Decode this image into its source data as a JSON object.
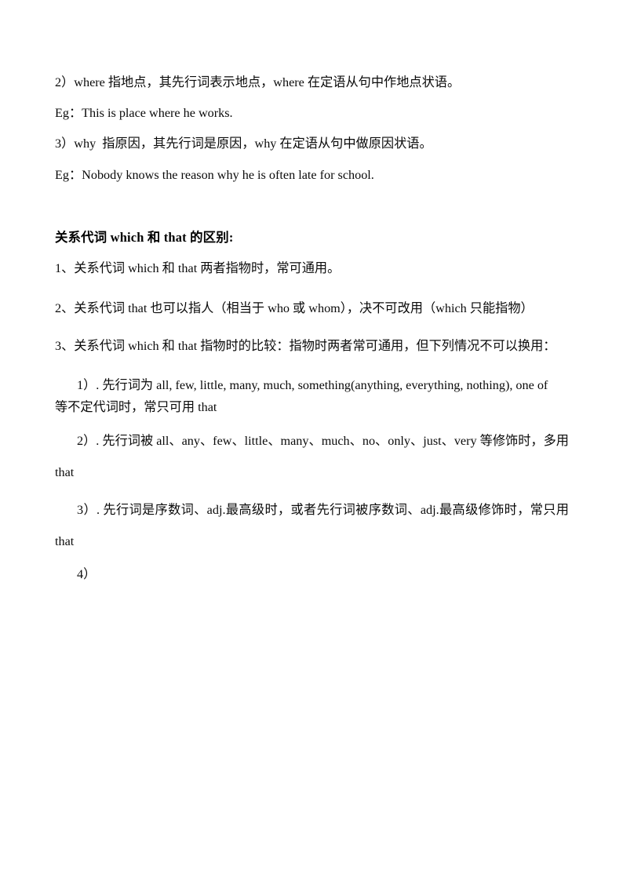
{
  "document": {
    "page_background": "#ffffff",
    "text_color": "#0a0a0a",
    "blocks": {
      "where_rule": "2）where 指地点，其先行词表示地点，where 在定语从句中作地点状语。",
      "where_example": "Eg：This is place where he works.",
      "why_rule": "3）why  指原因，其先行词是原因，why 在定语从句中做原因状语。",
      "why_example": "Eg：Nobody knows the reason why he is often late for school.",
      "section_heading": "关系代词 which 和 that 的区别:",
      "rule_1": "1、关系代词 which 和 that 两者指物时，常可通用。",
      "rule_2": "2、关系代词 that 也可以指人（相当于 who 或 whom），决不可改用（which 只能指物）",
      "rule_3": "3、关系代词 which 和 that 指物时的比较：指物时两者常可通用，但下列情况不可以换用：",
      "sub_1_line1": "1）. 先行词为 all, few, little, many, much, something(anything, everything, nothing), one of",
      "sub_1_line2": "等不定代词时，常只可用 that",
      "sub_2": "2）. 先行词被 all、any、few、little、many、much、no、only、just、very 等修饰时，多用 that",
      "sub_3": "3）. 先行词是序数词、adj.最高级时，或者先行词被序数词、adj.最高级修饰时，常只用 that",
      "sub_4": "4）"
    }
  }
}
